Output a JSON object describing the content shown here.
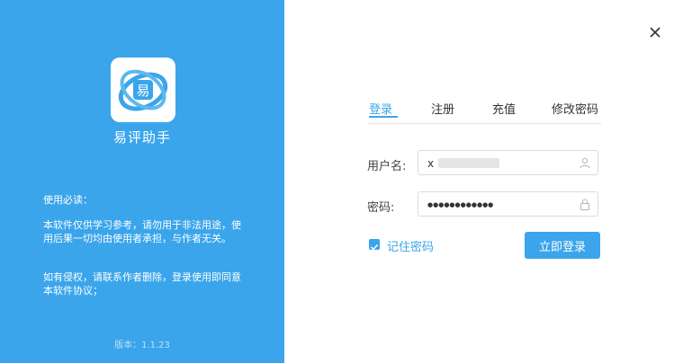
{
  "app": {
    "name": "易评助手",
    "version": "版本：1.1.23",
    "colors": {
      "brand": "#3aa5eb",
      "white": "#ffffff"
    }
  },
  "logo": {
    "char": "易",
    "icon": "app-logo"
  },
  "notice": {
    "title": "使用必读：",
    "para1": "本软件仅供学习参考，请勿用于非法用途，使用后果一切均由使用者承担，与作者无关。",
    "para2": "如有侵权，请联系作者删除，登录使用即同意本软件协议；"
  },
  "tabs": [
    {
      "label": "登录",
      "active": true
    },
    {
      "label": "注册",
      "active": false
    },
    {
      "label": "充值",
      "active": false
    },
    {
      "label": "修改密码",
      "active": false
    }
  ],
  "form": {
    "username_label": "用户名:",
    "username_value": "x",
    "password_label": "密码:",
    "password_value": "●●●●●●●●●●●●",
    "remember_label": "记住密码",
    "remember_checked": true,
    "login_button": "立即登录",
    "username_icon": "user-icon",
    "password_icon": "lock-icon"
  },
  "window": {
    "close_icon": "close-icon"
  }
}
